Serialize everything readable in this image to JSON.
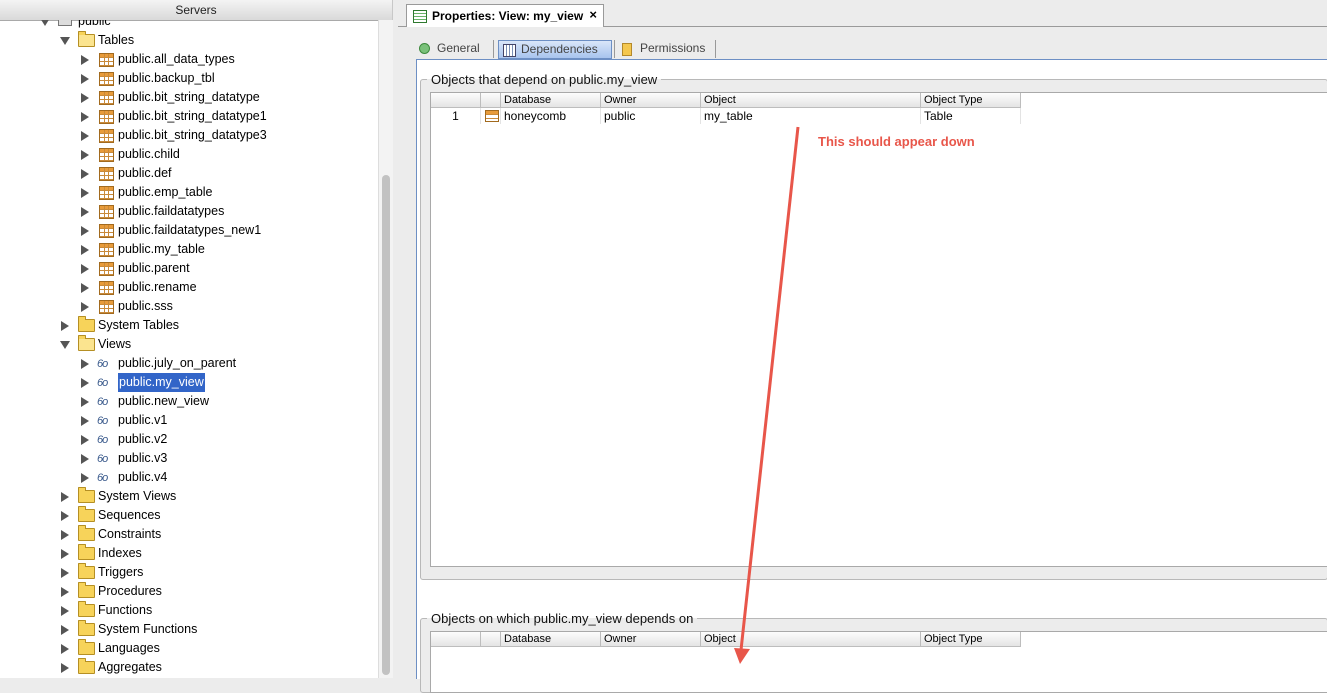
{
  "left_panel": {
    "header": "Servers",
    "schema": {
      "label": "public"
    },
    "tables_folder": {
      "label": "Tables"
    },
    "tables": [
      "public.all_data_types",
      "public.backup_tbl",
      "public.bit_string_datatype",
      "public.bit_string_datatype1",
      "public.bit_string_datatype3",
      "public.child",
      "public.def",
      "public.emp_table",
      "public.faildatatypes",
      "public.faildatatypes_new1",
      "public.my_table",
      "public.parent",
      "public.rename",
      "public.sss"
    ],
    "system_tables": "System Tables",
    "views_folder": {
      "label": "Views"
    },
    "views": [
      "public.july_on_parent",
      "public.my_view",
      "public.new_view",
      "public.v1",
      "public.v2",
      "public.v3",
      "public.v4"
    ],
    "selected_view": "public.my_view",
    "other_folders": [
      "System Views",
      "Sequences",
      "Constraints",
      "Indexes",
      "Triggers",
      "Procedures",
      "Functions",
      "System Functions",
      "Languages",
      "Aggregates"
    ]
  },
  "document_tab": {
    "title": "Properties: View: my_view",
    "close": "×"
  },
  "subtabs": {
    "general": "General",
    "dependencies": "Dependencies",
    "permissions": "Permissions",
    "active": "Dependencies"
  },
  "dependents_group": {
    "title": "Objects that depend on public.my_view",
    "columns": [
      "Database",
      "Owner",
      "Object",
      "Object Type"
    ],
    "rows": [
      {
        "num": "1",
        "database": "honeycomb",
        "owner": "public",
        "object": "my_table",
        "object_type": "Table"
      }
    ]
  },
  "dependencies_group": {
    "title": "Objects on which public.my_view depends on",
    "columns": [
      "Database",
      "Owner",
      "Object",
      "Object Type"
    ],
    "rows": []
  },
  "annotation": {
    "text": "This should appear down",
    "color": "#e8564a"
  },
  "colors": {
    "selection": "#3265c8",
    "accent_tab": "#a8c4ee"
  }
}
